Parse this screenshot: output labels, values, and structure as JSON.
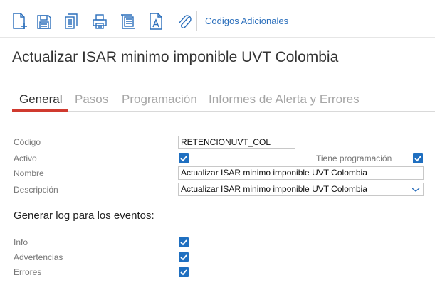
{
  "toolbar": {
    "icons": [
      "new-document-icon",
      "save-icon",
      "copy-icon",
      "print-icon",
      "report-icon",
      "text-document-icon",
      "attachment-icon"
    ],
    "link_label": "Codigos Adicionales",
    "icon_color": "#2a6ebb"
  },
  "page": {
    "title": "Actualizar ISAR minimo imponible UVT Colombia"
  },
  "tabs": [
    {
      "label": "General",
      "active": true
    },
    {
      "label": "Pasos",
      "active": false
    },
    {
      "label": "Programación",
      "active": false
    },
    {
      "label": "Informes de Alerta y Errores",
      "active": false
    }
  ],
  "form": {
    "codigo_label": "Código",
    "codigo_value": "RETENCIONUVT_COL",
    "activo_label": "Activo",
    "activo_checked": true,
    "programacion_label": "Tiene programación",
    "programacion_checked": true,
    "nombre_label": "Nombre",
    "nombre_value": "Actualizar ISAR minimo imponible UVT Colombia",
    "descripcion_label": "Descripción",
    "descripcion_value": "Actualizar ISAR minimo imponible UVT Colombia"
  },
  "log": {
    "title": "Generar log para los eventos:",
    "items": [
      {
        "label": "Info",
        "checked": true
      },
      {
        "label": "Advertencias",
        "checked": true
      },
      {
        "label": "Errores",
        "checked": true
      }
    ]
  },
  "colors": {
    "accent": "#d03a2f",
    "checkbox": "#1f6fc0",
    "link": "#2a6ebb"
  }
}
